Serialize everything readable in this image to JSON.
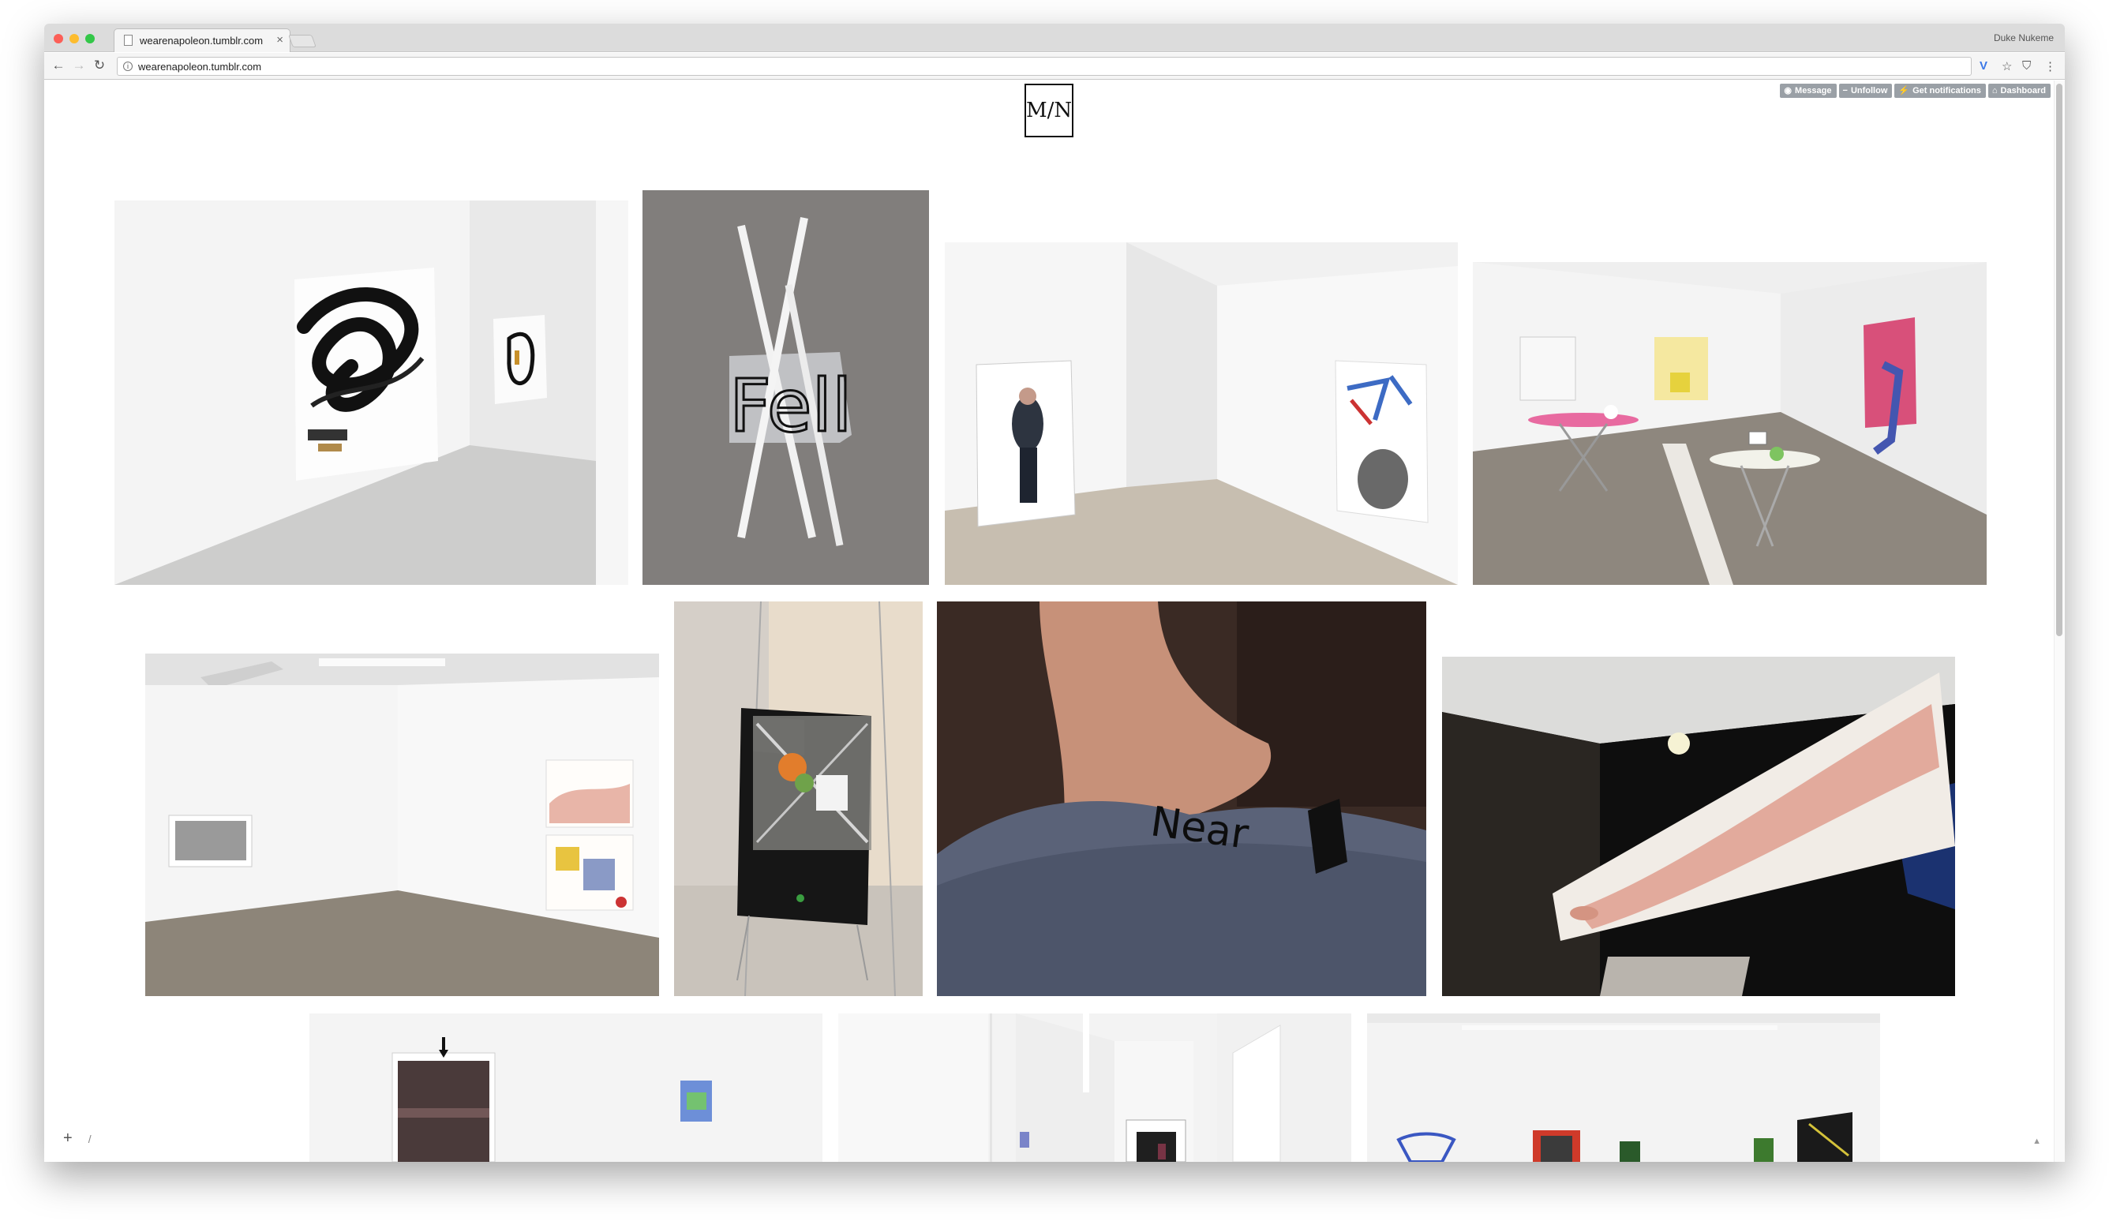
{
  "browser": {
    "tab_title": "wearenapoleon.tumblr.com",
    "tab_close": "×",
    "user_name": "Duke Nukeme",
    "url": "wearenapoleon.tumblr.com",
    "back": "←",
    "forward": "→",
    "reload": "↻",
    "info_icon": "i",
    "extension_icon": "V",
    "star_icon": "☆",
    "shield_icon": "⛉",
    "menu_icon": "⋮"
  },
  "page": {
    "logo_text": "M/N",
    "controls": [
      {
        "icon": "◉",
        "label": "Message"
      },
      {
        "icon": "−",
        "label": "Unfollow"
      },
      {
        "icon": "⚡",
        "label": "Get notifications"
      },
      {
        "icon": "⌂",
        "label": "Dashboard"
      }
    ],
    "artwork_texts": {
      "fell": "Fell",
      "near": "Near"
    },
    "bottom_plus": "+",
    "bottom_slash": "/",
    "to_top": "▲"
  },
  "colors": {
    "titlebar": "#dcdcdc",
    "close_light": "#fc5f57",
    "min_light": "#fdbc2e",
    "max_light": "#33c748",
    "control_button": "#9aa0a6",
    "extension_blue": "#3b78e7"
  }
}
